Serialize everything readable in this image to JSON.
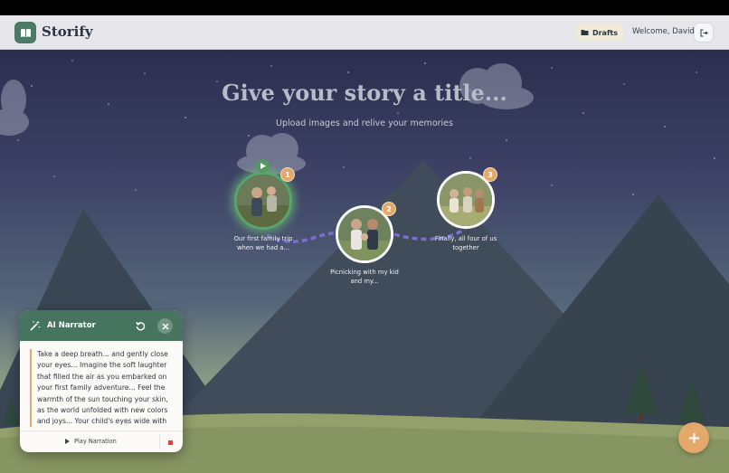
{
  "app": {
    "name": "Storify"
  },
  "header": {
    "drafts_label": "Drafts",
    "welcome_text": "Welcome, David"
  },
  "hero": {
    "title": "Give your story a title...",
    "subtitle": "Upload images and relive your memories"
  },
  "memories": [
    {
      "number": "1",
      "caption": "Our first family trip when we had a...",
      "active": true
    },
    {
      "number": "2",
      "caption": "Picnicking with my kid and my..."
    },
    {
      "number": "3",
      "caption": "Finally, all four of us together"
    }
  ],
  "narrator": {
    "title": "AI Narrator",
    "text": "Take a deep breath... and gently close your eyes... Imagine the soft laughter that filled the air as you embarked on your first family adventure... Feel the warmth of the sun touching your skin, as the world unfolded with new colors and joys... Your child's eyes wide with wonder, discovering",
    "play_label": "Play Narration"
  },
  "colors": {
    "brand": "#4c7a66",
    "accent": "#e3a96a",
    "stop": "#d9433b"
  },
  "icons": [
    "book-icon",
    "folder-icon",
    "logout-icon",
    "play-icon",
    "wand-icon",
    "refresh-icon",
    "close-icon",
    "stop-icon",
    "plus-icon"
  ]
}
